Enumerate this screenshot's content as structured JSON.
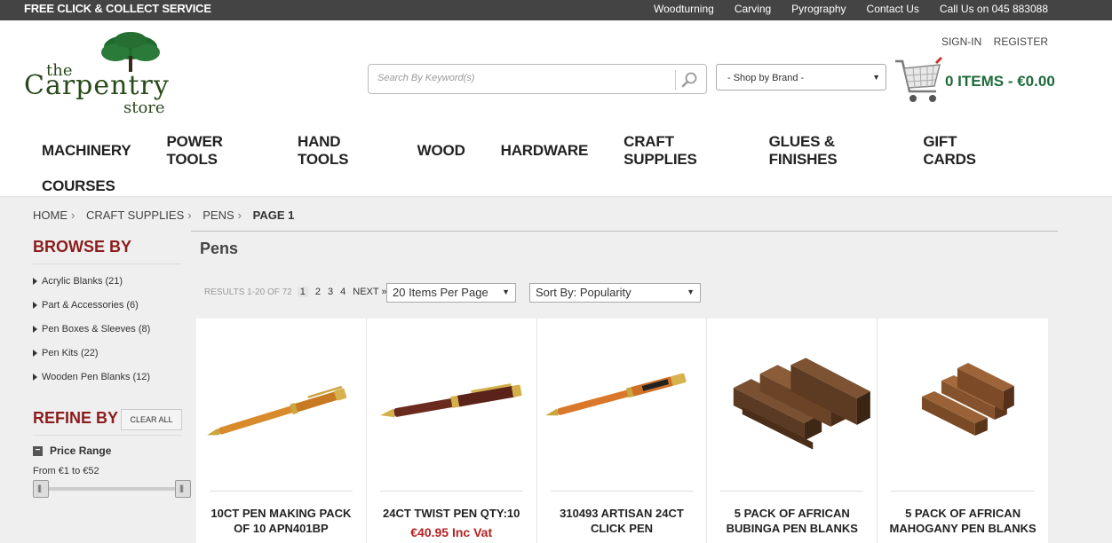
{
  "topbar": {
    "promo": "FREE CLICK & COLLECT SERVICE",
    "links": [
      "Woodturning",
      "Carving",
      "Pyrography",
      "Contact Us",
      "Call Us on 045 883088"
    ]
  },
  "header": {
    "logo": {
      "line1": "the",
      "line2": "Carpentry",
      "line3": "store"
    },
    "sign_in": "SIGN-IN",
    "register": "REGISTER",
    "search_placeholder": "Search By Keyword(s)",
    "brand_select": "- Shop by Brand -",
    "cart_text": "0 ITEMS - €0.00"
  },
  "nav": {
    "row1": [
      "MACHINERY",
      "POWER TOOLS",
      "HAND TOOLS",
      "WOOD",
      "HARDWARE",
      "CRAFT SUPPLIES",
      "GLUES & FINISHES",
      "GIFT CARDS"
    ],
    "row2": [
      "COURSES"
    ]
  },
  "breadcrumb": {
    "home": "HOME",
    "craft": "CRAFT SUPPLIES",
    "pens": "PENS",
    "page": "PAGE 1"
  },
  "sidebar": {
    "browse_title": "BROWSE BY",
    "categories": [
      "Acrylic Blanks (21)",
      "Part & Accessories (6)",
      "Pen Boxes & Sleeves (8)",
      "Pen Kits (22)",
      "Wooden Pen Blanks (12)"
    ],
    "refine_title": "REFINE BY",
    "clear_all": "CLEAR ALL",
    "price_range_label": "Price Range",
    "price_from": "From €1 to €52"
  },
  "main": {
    "title": "Pens",
    "results": "RESULTS 1-20 OF 72",
    "pages": [
      "1",
      "2",
      "3",
      "4"
    ],
    "next": "NEXT »",
    "per_page": "20 Items Per Page",
    "sort_by": "Sort By: Popularity"
  },
  "products": [
    {
      "name": "10CT PEN MAKING PACK OF 10 APN401BP",
      "price": ""
    },
    {
      "name": "24CT TWIST PEN QTY:10",
      "price": "€40.95 Inc Vat"
    },
    {
      "name": "310493 ARTISAN 24CT CLICK PEN",
      "price": ""
    },
    {
      "name": "5 PACK OF AFRICAN BUBINGA PEN BLANKS",
      "price": ""
    },
    {
      "name": "5 PACK OF AFRICAN MAHOGANY PEN BLANKS",
      "price": ""
    }
  ],
  "colors": {
    "brand_green": "#1d6b3a",
    "accent_red": "#8c1c1c",
    "price_red": "#b22222"
  }
}
